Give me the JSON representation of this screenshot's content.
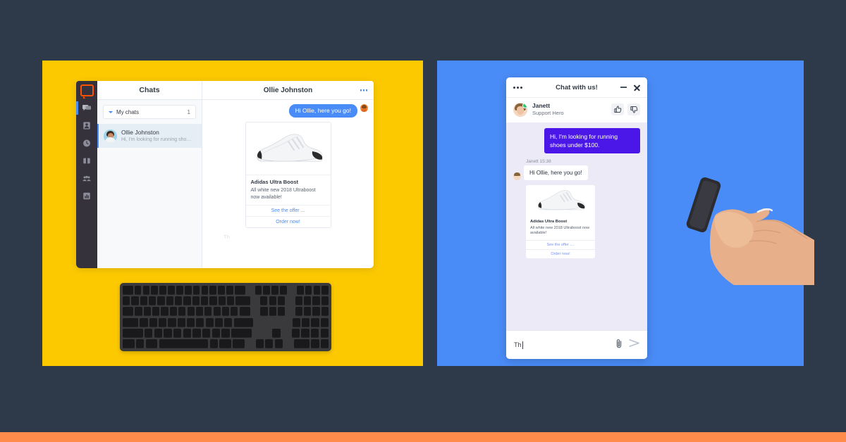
{
  "theme": {
    "page_bg": "#2e3a49",
    "panel_yellow": "#fcc900",
    "panel_blue": "#4a8cf7",
    "bottom_strip": "#ff8c4b",
    "agent_bubble": "#4a8cf7",
    "visitor_bubble": "#4b17e8",
    "widget_bg": "#eceaf7",
    "brand_orange": "#ff5100"
  },
  "desktop_app": {
    "logo_icon": "speech-bubble-logo",
    "rail_icons": [
      "chats-icon",
      "contacts-icon",
      "archives-icon",
      "engage-icon",
      "team-icon",
      "reports-icon"
    ],
    "list": {
      "header": "Chats",
      "group_label": "My chats",
      "group_count": "1",
      "chevron_icon": "chevron-down-icon",
      "rows": [
        {
          "name": "Ollie Johnston",
          "preview": "Hi, I'm looking for running shoes...",
          "avatar": "visitor-avatar"
        }
      ]
    },
    "conversation": {
      "title": "Ollie Johnston",
      "menu_icon": "more-options-icon",
      "messages": [
        {
          "from": "agent",
          "text": "Hi Ollie, here you go!"
        }
      ],
      "product_card": {
        "image": "white-running-shoe",
        "title": "Adidas Ultra Boost",
        "description": "All white new 2018 Ultraboost now available!",
        "actions": [
          "See the offer ...",
          "Order now!"
        ]
      },
      "typing_preview": "Th"
    }
  },
  "widget": {
    "header": {
      "menu_icon": "more-options-icon",
      "title": "Chat with us!",
      "minimize_icon": "minimize-icon",
      "close_icon": "close-icon"
    },
    "agent": {
      "name": "Janett",
      "role": "Support Hero",
      "avatar": "agent-avatar",
      "status": "online",
      "rate_up_icon": "thumbs-up-icon",
      "rate_down_icon": "thumbs-down-icon"
    },
    "messages": [
      {
        "from": "visitor",
        "text": "Hi, I'm looking for running shoes under $100."
      },
      {
        "from": "agent",
        "meta": "Janett 15:38",
        "text": "Hi Ollie, here you go!"
      }
    ],
    "product_card": {
      "image": "white-running-shoe",
      "title": "Adidas Ultra Boost",
      "description": "All white new 2018 Ultraboost now available!",
      "actions": [
        "See the offer ....",
        "Order now!"
      ]
    },
    "input": {
      "value": "Th",
      "attach_icon": "paperclip-icon",
      "send_icon": "send-icon"
    }
  },
  "props": {
    "keyboard": "wireless-keyboard",
    "hand": "hand-holding-phone"
  }
}
